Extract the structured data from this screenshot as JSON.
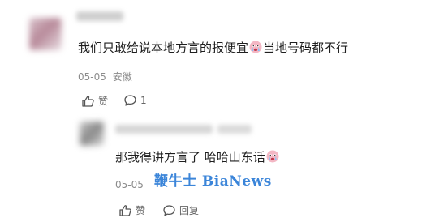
{
  "comment1": {
    "text_before_emoji": "我们只敢给说本地方言的报便宜",
    "text_after_emoji": "当地号码都不行",
    "date": "05-05",
    "location": "安徽",
    "like_label": "赞",
    "reply_count": "1"
  },
  "comment2": {
    "text": "那我得讲方言了 哈哈山东话",
    "date": "05-05",
    "like_label": "赞",
    "reply_label": "回复"
  },
  "watermark": {
    "text": "鞭牛士 BiaNews"
  },
  "icons": {
    "like": "thumbs-up-icon",
    "reply": "comment-bubble-icon",
    "emoji": "crying-face-emoji"
  }
}
